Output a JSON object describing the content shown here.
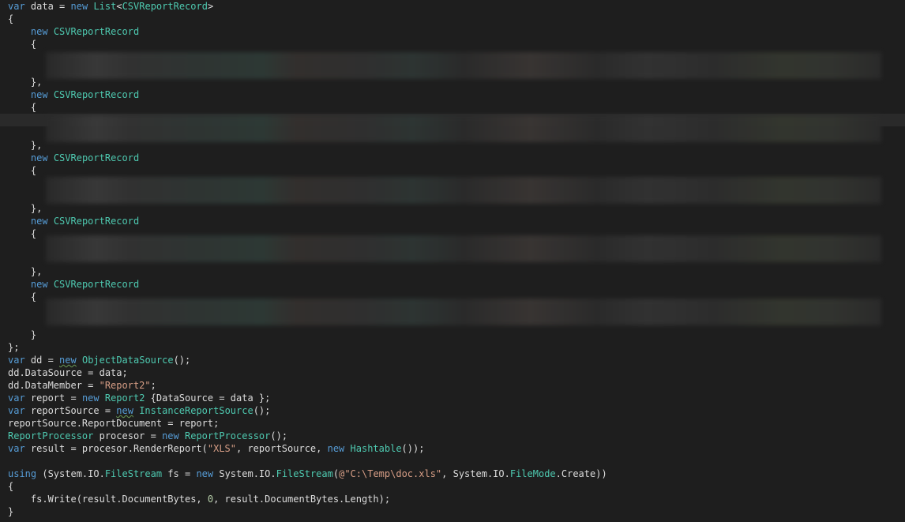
{
  "code": {
    "blurred_regions": 5,
    "kw_var": "var",
    "kw_new": "new",
    "kw_using": "using",
    "data_name": "data",
    "list_type": "List",
    "record_type": "CSVReportRecord",
    "object_data_source": "ObjectDataSource",
    "report2": "Report2",
    "instance_report_source": "InstanceReportSource",
    "report_processor": "ReportProcessor",
    "hashtable": "Hashtable",
    "file_stream": "FileStream",
    "file_mode": "FileMode",
    "str_report2": "\"Report2\"",
    "str_xls": "\"XLS\"",
    "str_path": "@\"C:\\Temp\\doc.xls\"",
    "num_zero": "0"
  }
}
